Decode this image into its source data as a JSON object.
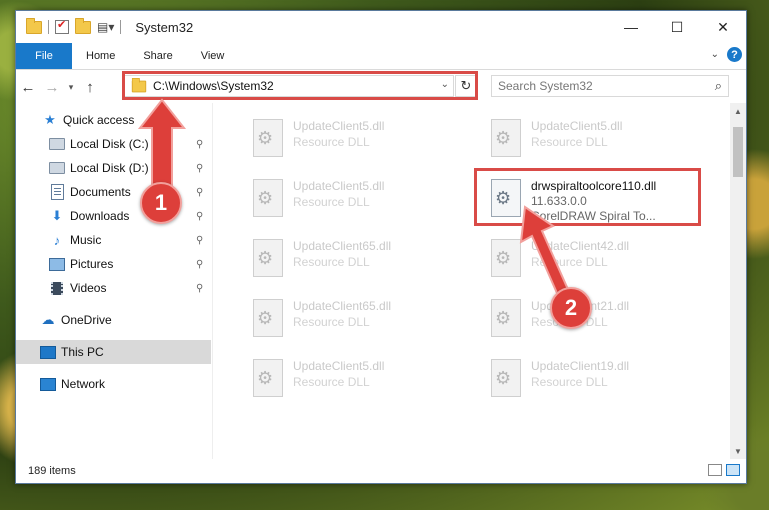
{
  "window": {
    "title": "System32",
    "controls": {
      "minimize": "—",
      "maximize": "☐",
      "close": "✕"
    }
  },
  "ribbon": {
    "tabs": [
      "File",
      "Home",
      "Share",
      "View"
    ],
    "collapse": "⌄",
    "help": "?"
  },
  "navigation": {
    "back": "←",
    "forward": "→",
    "recent": "▾",
    "up": "↑",
    "address": "C:\\Windows\\System32",
    "address_dropdown": "⌄",
    "refresh": "↻",
    "search_placeholder": "Search System32",
    "search_icon": "⌕"
  },
  "sidebar": {
    "items": [
      {
        "label": "Quick access",
        "icon": "star-icon",
        "glyph": "★",
        "pinned": false
      },
      {
        "label": "Local Disk (C:)",
        "icon": "drive-icon",
        "pinned": true
      },
      {
        "label": "Local Disk (D:)",
        "icon": "drive-icon",
        "pinned": true
      },
      {
        "label": "Documents",
        "icon": "document-icon",
        "pinned": true
      },
      {
        "label": "Downloads",
        "icon": "download-icon",
        "glyph": "⬇",
        "pinned": true
      },
      {
        "label": "Music",
        "icon": "music-icon",
        "glyph": "♪",
        "pinned": true
      },
      {
        "label": "Pictures",
        "icon": "pictures-icon",
        "pinned": true
      },
      {
        "label": "Videos",
        "icon": "videos-icon",
        "pinned": true
      },
      {
        "label": "OneDrive",
        "icon": "cloud-icon",
        "glyph": "☁",
        "pinned": false
      },
      {
        "label": "This PC",
        "icon": "computer-icon",
        "pinned": false,
        "selected": true
      },
      {
        "label": "Network",
        "icon": "network-icon",
        "pinned": false
      }
    ],
    "pin_glyph": "📌"
  },
  "files": {
    "left_column": [
      {
        "name": "UpdateClient5.dll",
        "type": "Resource DLL"
      },
      {
        "name": "UpdateClient5.dll",
        "type": "Resource DLL"
      },
      {
        "name": "UpdateClient65.dll",
        "type": "Resource DLL"
      },
      {
        "name": "UpdateClient65.dll",
        "type": "Resource DLL"
      },
      {
        "name": "UpdateClient5.dll",
        "type": "Resource DLL"
      }
    ],
    "right_column": [
      {
        "name": "UpdateClient5.dll",
        "type": "Resource DLL"
      },
      {
        "name": "UpdateClient42.dll",
        "type": "Resource DLL"
      },
      {
        "name": "UpdateClient21.dll",
        "type": "Resource DLL"
      },
      {
        "name": "UpdateClient19.dll",
        "type": "Resource DLL"
      }
    ],
    "highlighted": {
      "name": "drwspiraltoolcore110.dll",
      "version": "11.633.0.0",
      "description": "CorelDRAW Spiral To..."
    }
  },
  "status": {
    "item_count": "189 items"
  },
  "annotations": {
    "step1": "1",
    "step2": "2",
    "color": "#dd3f3a"
  }
}
